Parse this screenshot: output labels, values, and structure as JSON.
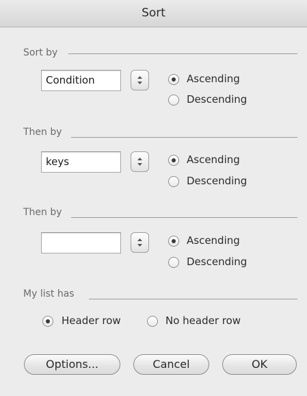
{
  "dialog": {
    "title": "Sort"
  },
  "sort_by": {
    "label": "Sort by",
    "value": "Condition",
    "ascending_label": "Ascending",
    "descending_label": "Descending",
    "selected": "Ascending"
  },
  "then_by_1": {
    "label": "Then by",
    "value": "keys",
    "ascending_label": "Ascending",
    "descending_label": "Descending",
    "selected": "Ascending"
  },
  "then_by_2": {
    "label": "Then by",
    "value": "",
    "ascending_label": "Ascending",
    "descending_label": "Descending",
    "selected": "Ascending"
  },
  "list_has": {
    "label": "My list has",
    "header_row_label": "Header row",
    "no_header_row_label": "No header row",
    "selected": "Header row"
  },
  "buttons": {
    "options": "Options...",
    "cancel": "Cancel",
    "ok": "OK"
  }
}
